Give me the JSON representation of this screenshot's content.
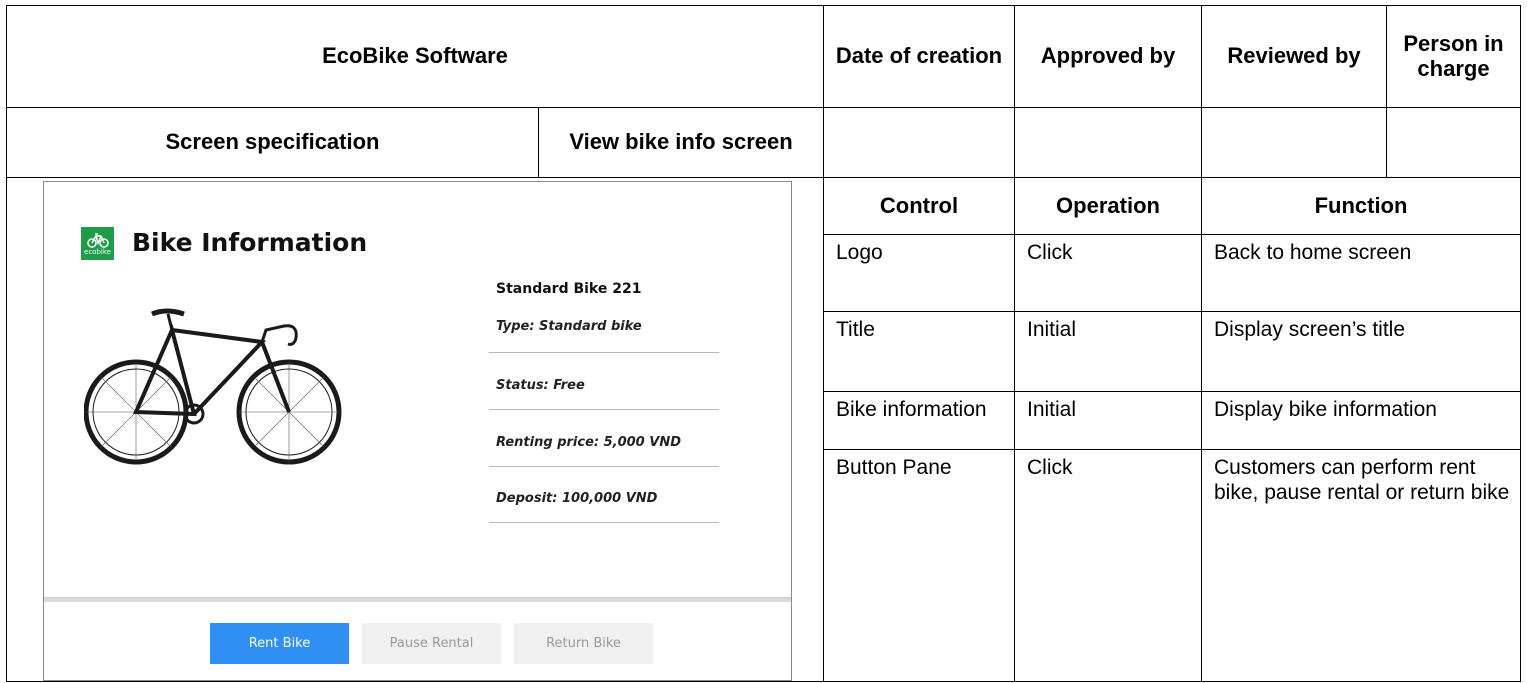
{
  "header": {
    "company": "EcoBike Software",
    "date_of_creation": "Date of creation",
    "approved_by": "Approved by",
    "reviewed_by": "Reviewed by",
    "person_in_charge": "Person in charge",
    "screen_specification": "Screen specification",
    "screen_name": "View bike info screen"
  },
  "columns": {
    "control": "Control",
    "operation": "Operation",
    "function": "Function"
  },
  "rows": [
    {
      "control": "Logo",
      "operation": "Click",
      "function": "Back to home screen"
    },
    {
      "control": "Title",
      "operation": "Initial",
      "function": "Display screen’s title"
    },
    {
      "control": "Bike information",
      "operation": "Initial",
      "function": "Display bike information"
    },
    {
      "control": "Button Pane",
      "operation": "Click",
      "function": "Customers can perform rent bike, pause rental or return bike"
    }
  ],
  "mockup": {
    "logo_text": "ecobike",
    "logo_icon": "bike-icon",
    "title": "Bike Information",
    "bike_name": "Standard Bike 221",
    "fields": [
      "Type: Standard bike",
      "Status: Free",
      "Renting price: 5,000 VND",
      "Deposit: 100,000 VND"
    ],
    "buttons": {
      "rent": "Rent Bike",
      "pause": "Pause Rental",
      "return": "Return Bike"
    },
    "colors": {
      "logo_bg": "#1e9c47",
      "primary_button": "#2f8ff2",
      "disabled_button": "#f0f0f0"
    }
  }
}
